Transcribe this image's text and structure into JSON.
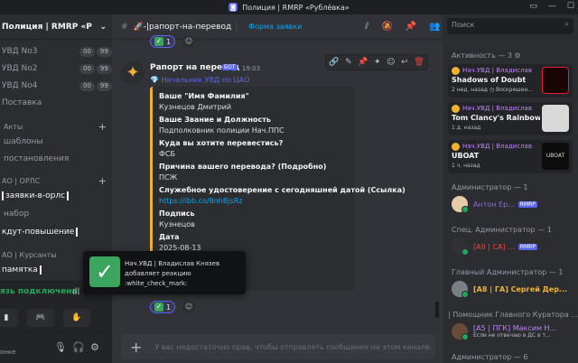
{
  "window": {
    "title": "Полиция | RMRP «Рублёвка»"
  },
  "sidebar": {
    "server_name": "Полиция | RMRP «Рублёвка»",
    "channels": [
      {
        "label": "УВД No3",
        "counts": [
          "00",
          "99"
        ]
      },
      {
        "label": "УВД No2",
        "counts": [
          "00",
          "99"
        ]
      },
      {
        "label": "УВД No4",
        "counts": [
          "00",
          "99"
        ]
      },
      {
        "label": "Поставка"
      },
      {
        "label": "Акты",
        "category": true
      },
      {
        "label": "шаблоны"
      },
      {
        "label": "постановления"
      },
      {
        "label": "АО | ОРЛС",
        "category": true
      },
      {
        "label": "заявки-в-орлс"
      },
      {
        "label": "набор"
      },
      {
        "label": "кдут-повышение"
      },
      {
        "label": "АО | Курсанты",
        "category": true
      },
      {
        "label": "памятка"
      }
    ],
    "voice_status": "язь подключена",
    "user_status": "онке"
  },
  "chat": {
    "channel_name": "🚀-|рапорт-на-перевод",
    "form_link": "Форма заявки",
    "top_reaction_count": "1",
    "author": "Рапорт на перевод",
    "bot_tag": "БОТ",
    "time": "19:03",
    "replied_to": "Начальник УВД по ЦАО",
    "fields": [
      {
        "name": "Ваше \"Имя Фамилия\"",
        "value": "Кузнецов Дмитрий"
      },
      {
        "name": "Ваше  Звание и Должность",
        "value": "Подполковник полиции Нач.ППС"
      },
      {
        "name": "Куда вы хотите перевестись?",
        "value": "ФСБ"
      },
      {
        "name": "Причина вашего перевода? (Подробно)",
        "value": "ПСЖ"
      },
      {
        "name": "Служебное удостоверение с сегодняшней датой  (Ссылка)",
        "value": "https://ibb.co/8nhBjsRz"
      },
      {
        "name": "Подпись",
        "value": "Кузнецов"
      },
      {
        "name": "Дата",
        "value": "2025-08-13"
      }
    ],
    "bottom_reaction_count": "1",
    "composer_placeholder": "У вас недостаточно прав, чтобы отправлять сообщения на этом канале."
  },
  "toast": {
    "line1": "Нач.УВД | Владислав Князев",
    "line2": "добавляет реакцию",
    "line3": ":white_check_mark:"
  },
  "members": {
    "search_placeholder": "Поиск",
    "activity_header": "Активность — 3",
    "activities": [
      {
        "owner": "Нач.УВД | Владислав",
        "game": "Shadows of Doubt",
        "meta": "2 нед. назад  ◷ Воскрешен..."
      },
      {
        "owner": "Нач.УВД | Владислав",
        "game": "Tom Clancy's Rainbow Six ...",
        "meta": "1 д. назад"
      },
      {
        "owner": "Нач.УВД | Владислав",
        "game": "UBOAT",
        "meta": "1 ч. назад"
      }
    ],
    "groups": [
      {
        "header": "Администратор — 1",
        "name": "Антон Ер...",
        "tag": "RMRP",
        "color": "#8e6bd8"
      },
      {
        "header": "Спец. Администратор — 1",
        "name": "[А9 | СА] ...",
        "tag": "RMRP",
        "color": "#e84545"
      },
      {
        "header": "Главный Администратор — 1",
        "name": "[А8 | ГА] Сергей Дер...",
        "color": "#f0b232"
      },
      {
        "header": "| Помощник Главного Куратора ...",
        "name": "[А5 | ПГК] Максим Н...",
        "sub": "Если не отвечаю в ДС в т...",
        "color": "#c084fc"
      },
      {
        "header": "Администратор — 6"
      }
    ]
  },
  "colors": {
    "accent": "#5865f2",
    "embed_bar": "#f0b232",
    "online": "#23a55a",
    "link": "#00a8fc"
  }
}
